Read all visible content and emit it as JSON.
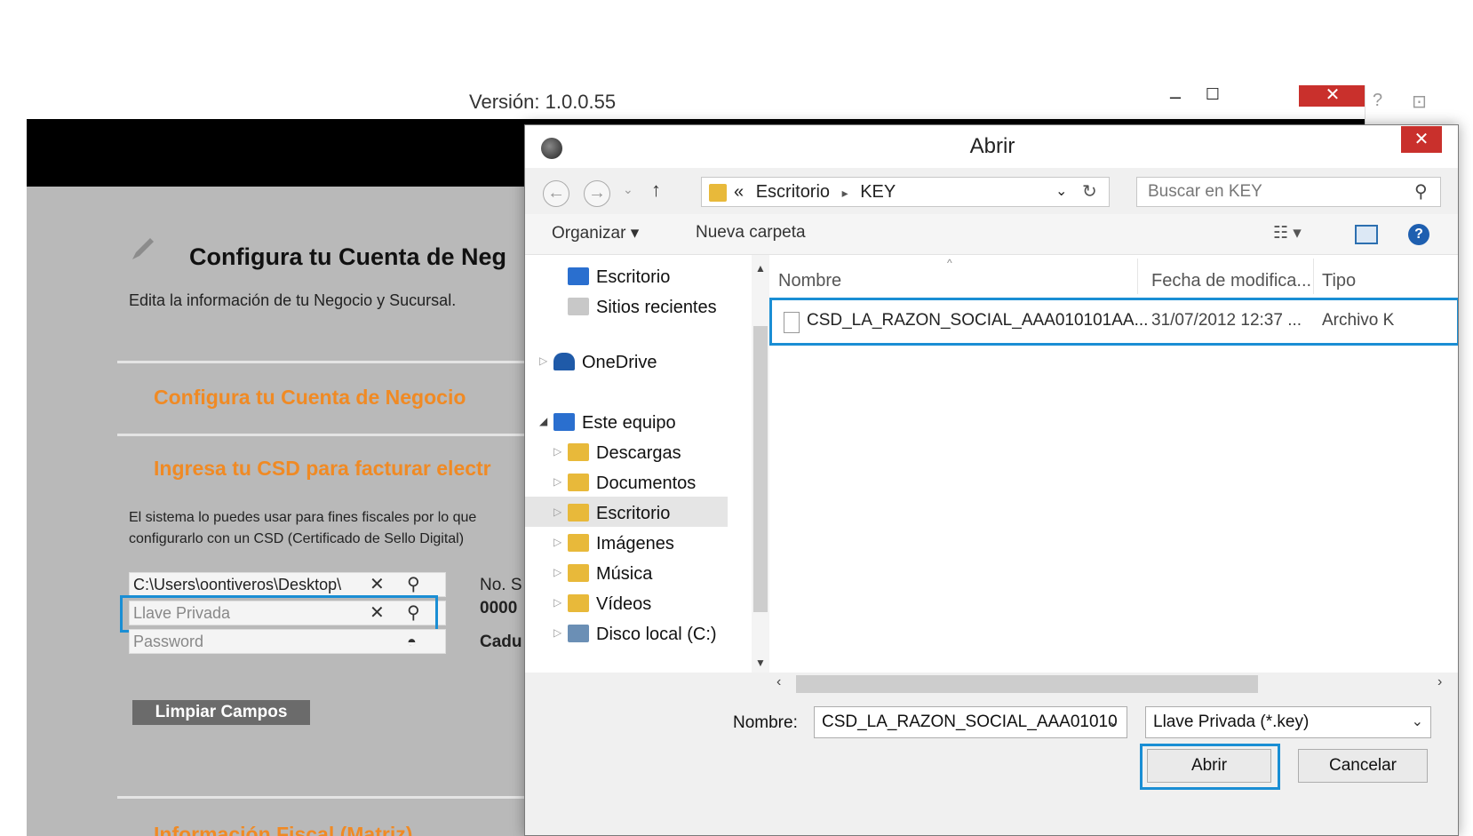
{
  "app": {
    "version": "Versión: 1.0.0.55",
    "minimize": "–",
    "maximize": "☐",
    "close": "✕",
    "page_title": "Configura tu Cuenta de Neg",
    "subtitle": "Edita la información de tu Negocio y Sucursal.",
    "section1": "Configura tu Cuenta de Negocio",
    "section2": "Ingresa tu CSD para facturar electr",
    "body_line1": "El sistema lo puedes usar para fines fiscales por lo que",
    "body_line2": "configurarlo con un CSD (Certificado de Sello Digital)",
    "cert_path": "C:\\Users\\oontiveros\\Desktop\\",
    "key_placeholder": "Llave Privada",
    "password_placeholder": "Password",
    "label_no": "No. S",
    "label_num": "0000",
    "label_cad": "Cadu",
    "clear_button": "Limpiar Campos",
    "section3": "Información Fiscal (Matriz)",
    "highlight_color": "#1a8ed4",
    "accent_color": "#f08a24"
  },
  "right_strip": {
    "help": "?",
    "pin": "⊡"
  },
  "dialog": {
    "title": "Abrir",
    "close": "✕",
    "back": "←",
    "forward": "→",
    "recent": "⌄",
    "up": "↑",
    "breadcrumb_prefix": "«",
    "breadcrumb_1": "Escritorio",
    "breadcrumb_sep": "▸",
    "breadcrumb_2": "KEY",
    "addr_dropdown": "⌄",
    "refresh": "↻",
    "search_placeholder": "Buscar en KEY",
    "search_icon": "⚲",
    "organize": "Organizar ▾",
    "new_folder": "Nueva carpeta",
    "view_icon": "☷ ▾",
    "help_icon": "?",
    "nav": {
      "desktop_top": "Escritorio",
      "recent": "Sitios recientes",
      "onedrive": "OneDrive",
      "this_pc": "Este equipo",
      "downloads": "Descargas",
      "documents": "Documentos",
      "desktop": "Escritorio",
      "images": "Imágenes",
      "music": "Música",
      "videos": "Vídeos",
      "local_disk": "Disco local (C:)"
    },
    "columns": {
      "name": "Nombre",
      "modified": "Fecha de modifica...",
      "type": "Tipo"
    },
    "file": {
      "name": "CSD_LA_RAZON_SOCIAL_AAA010101AA...",
      "modified": "31/07/2012 12:37 ...",
      "type": "Archivo K"
    },
    "filename_label": "Nombre:",
    "filename_value": "CSD_LA_RAZON_SOCIAL_AAA01010",
    "filetype_value": "Llave Privada (*.key)",
    "open_button": "Abrir",
    "cancel_button": "Cancelar"
  }
}
